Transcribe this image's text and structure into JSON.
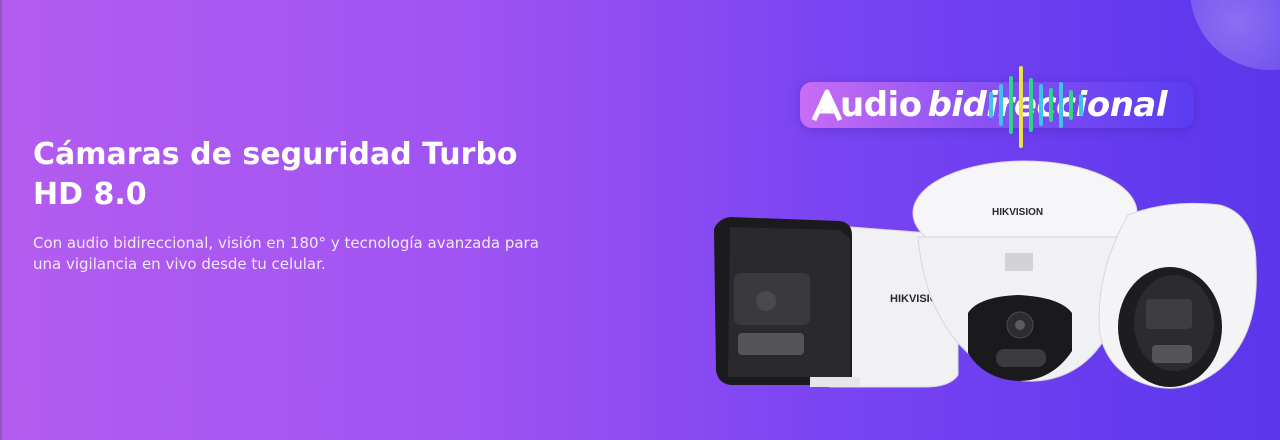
{
  "hero": {
    "title": "Cámaras de seguridad Turbo HD 8.0",
    "description": "Con audio bidireccional, visión en 180° y tecnología avanzada para una vigilancia en vivo desde tu celular."
  },
  "badge": {
    "text_regular": "udio",
    "text_italic": "bidireccional"
  },
  "products": {
    "brand": "HIKVISION",
    "icons": [
      "bullet-camera-icon",
      "dome-camera-icon",
      "turret-camera-icon"
    ]
  },
  "colors": {
    "gradient_start": "#b35cf0",
    "gradient_end": "#5a36ec",
    "wave_green": "#2fd48a",
    "wave_yellow": "#e8e24a",
    "wave_cyan": "#3fc3e6"
  }
}
